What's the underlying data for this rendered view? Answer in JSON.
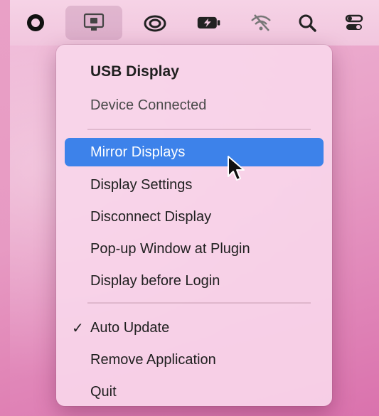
{
  "menubar": {
    "icons": [
      "record-icon",
      "usb-display-icon",
      "creative-cloud-icon",
      "battery-icon",
      "wifi-off-icon",
      "search-icon",
      "control-center-icon"
    ]
  },
  "menu": {
    "title": "USB Display",
    "status": "Device Connected",
    "group1": [
      {
        "label": "Mirror Displays"
      },
      {
        "label": "Display Settings"
      },
      {
        "label": "Disconnect Display"
      },
      {
        "label": "Pop-up Window at Plugin"
      },
      {
        "label": "Display before Login"
      }
    ],
    "group2": [
      {
        "label": "Auto Update",
        "checked": true,
        "check_mark": "✓"
      },
      {
        "label": "Remove Application"
      },
      {
        "label": "Quit"
      }
    ],
    "highlight_color": "#3d82ea"
  }
}
